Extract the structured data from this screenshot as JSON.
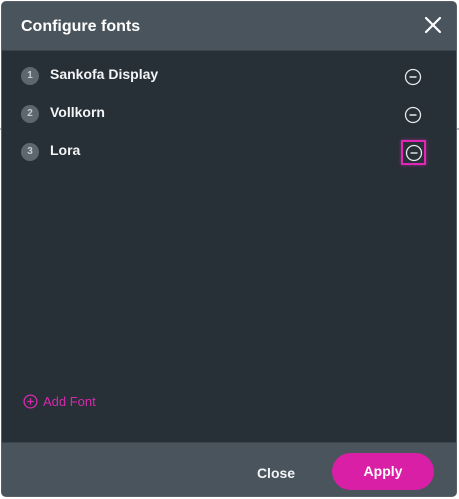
{
  "dialog": {
    "title": "Configure fonts",
    "close_icon": "close-x-icon"
  },
  "fonts": [
    {
      "index": "1",
      "name": "Sankofa Display"
    },
    {
      "index": "2",
      "name": "Vollkorn"
    },
    {
      "index": "3",
      "name": "Lora"
    }
  ],
  "add_font": {
    "label": "Add Font",
    "icon": "plus-circle-icon"
  },
  "footer": {
    "close_label": "Close",
    "apply_label": "Apply"
  },
  "colors": {
    "accent": "#d81fa6",
    "panel_bg": "#283037",
    "header_bg": "#4a545d",
    "highlight_border": "#e026b5"
  }
}
